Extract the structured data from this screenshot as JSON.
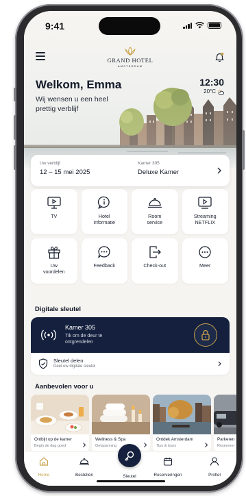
{
  "status_bar": {
    "time": "9:41"
  },
  "header": {
    "brand_name": "GRAND HOTEL",
    "brand_city": "AMSTERDAM"
  },
  "welcome": {
    "title": "Welkom, Emma",
    "subtitle": "Wij wensen u een heel prettig verblijf"
  },
  "clock": {
    "time": "12:30",
    "weather": "20°C"
  },
  "stay": {
    "label": "Uw verblijf",
    "dates": "12 – 15 mei 2025",
    "room_label": "Kamer 305",
    "room_type": "Deluxe Kamer"
  },
  "services": [
    {
      "label": "TV",
      "icon": "tv-icon"
    },
    {
      "label": "Hotel\ninformatie",
      "icon": "info-icon"
    },
    {
      "label": "Room\nservice",
      "icon": "cloche-icon"
    },
    {
      "label": "Streaming\nNETFLIX",
      "icon": "play-icon"
    },
    {
      "label": "Uw\nvoordelen",
      "icon": "gift-icon"
    },
    {
      "label": "Feedback",
      "icon": "chat-icon"
    },
    {
      "label": "Check-out",
      "icon": "door-exit-icon"
    },
    {
      "label": "Meer",
      "icon": "more-icon"
    }
  ],
  "digital_key": {
    "section_title": "Digitale sleutel",
    "room": "Kamer 305",
    "description": "Tik om de deur te ontgrendelen",
    "share_title": "Sleutel delen",
    "share_subtitle": "Deel uw digitale sleutel"
  },
  "recommendations": {
    "section_title": "Aanbevolen voor u",
    "items": [
      {
        "title": "Ontbijt op de kamer",
        "subtitle": "Begin de dag goed"
      },
      {
        "title": "Wellness & Spa",
        "subtitle": "Ontspanning"
      },
      {
        "title": "Ontdek Amsterdam",
        "subtitle": "Tips & tours"
      },
      {
        "title": "Parkeren",
        "subtitle": "Reserveer"
      }
    ]
  },
  "tabbar": {
    "home": "Home",
    "order": "Bestellen",
    "key": "Sleutel",
    "reservations": "Reserveringen",
    "profile": "Profiel"
  },
  "colors": {
    "navy": "#14203d",
    "gold": "#c9a24a",
    "background": "#f6f4f1"
  }
}
